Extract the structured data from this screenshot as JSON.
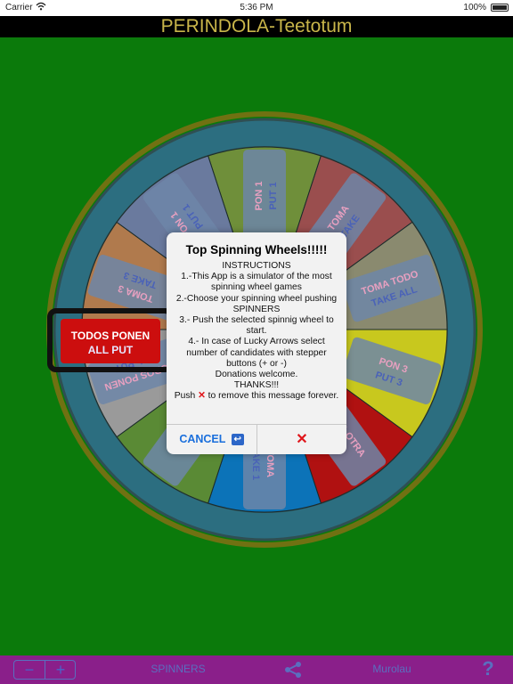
{
  "status_bar": {
    "carrier": "Carrier",
    "time": "5:36 PM",
    "battery": "100%"
  },
  "title": "PERINDOLA-Teetotum",
  "wheel": {
    "pointer_label_line1": "TODOS PONEN",
    "pointer_label_line2": "ALL PUT",
    "segments": [
      {
        "line1": "PON 1",
        "line2": "PUT 1",
        "color": "#6f8f3a"
      },
      {
        "line1": "TOMA",
        "line2": "TAKE",
        "color": "#9a4e4e"
      },
      {
        "line1": "TOMA TODO",
        "line2": "TAKE ALL",
        "color": "#8a8a6f"
      },
      {
        "line1": "PON 3",
        "line2": "PUT 3",
        "color": "#c8c81e"
      },
      {
        "line1": "TIRA OTRA",
        "line2": "SPIN",
        "color": "#b01111"
      },
      {
        "line1": "TOMA",
        "line2": "TAKE 1",
        "color": "#0c73b8"
      },
      {
        "line1": "PON 2",
        "line2": "PUT 2",
        "color": "#5a8a35"
      },
      {
        "line1": "TODOS PONEN",
        "line2": "ALL PUT",
        "color": "#9a9a9a"
      },
      {
        "line1": "TOMA 3",
        "line2": "TAKE 3",
        "color": "#b07a4d"
      },
      {
        "line1": "PON 1",
        "line2": "PUT 1",
        "color": "#6a7a9e"
      }
    ],
    "colors": {
      "rim": "#2c6e80",
      "rim_ring": "#2f4f52",
      "glow": "#c46a1a",
      "card": "#6d86a8",
      "card_text": "#4a62b8",
      "card_text_pink": "#e8a0c0"
    }
  },
  "modal": {
    "title": "Top Spinning Wheels!!!!!",
    "lines": [
      "INSTRUCTIONS",
      "1.-This App is a simulator of the most spinning wheel games",
      "2.-Choose your spinning wheel pushing SPINNERS",
      "3.- Push the selected spinnig wheel to start.",
      "4.- In case of Lucky Arrows select number of candidates with stepper buttons (+ or -)",
      "Donations welcome.",
      "THANKS!!!"
    ],
    "push_prefix": "Push",
    "x_mark": "✕",
    "push_suffix": "to remove this message forever.",
    "cancel_label": "CANCEL",
    "cancel_icon": "↩",
    "confirm_label": "✕"
  },
  "bottom_bar": {
    "minus": "−",
    "plus": "+",
    "spinners_label": "SPINNERS",
    "user_label": "Murolau",
    "help_label": "?"
  }
}
